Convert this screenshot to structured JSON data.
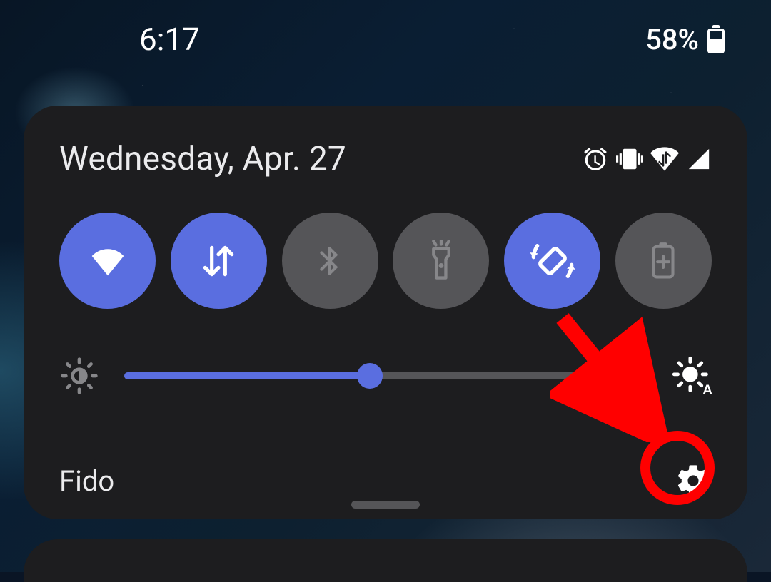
{
  "statusbar": {
    "time": "6:17",
    "battery_percent": "58%"
  },
  "panel": {
    "date": "Wednesday, Apr. 27",
    "status_icons": {
      "alarm": "alarm-icon",
      "vibrate": "vibrate-icon",
      "wifi": "wifi-icon",
      "signal": "cell-signal-icon"
    },
    "toggles": [
      {
        "name": "wifi-toggle",
        "active": true,
        "icon": "wifi"
      },
      {
        "name": "mobile-data-toggle",
        "active": true,
        "icon": "mobile-data"
      },
      {
        "name": "bluetooth-toggle",
        "active": false,
        "icon": "bluetooth"
      },
      {
        "name": "flashlight-toggle",
        "active": false,
        "icon": "flashlight"
      },
      {
        "name": "auto-rotate-toggle",
        "active": true,
        "icon": "auto-rotate"
      },
      {
        "name": "battery-saver-toggle",
        "active": false,
        "icon": "battery-saver"
      }
    ],
    "brightness": {
      "value": 47,
      "auto": true
    },
    "carrier": "Fido"
  },
  "annotation": {
    "note": "arrow pointing to settings gear, red circle highlight"
  }
}
